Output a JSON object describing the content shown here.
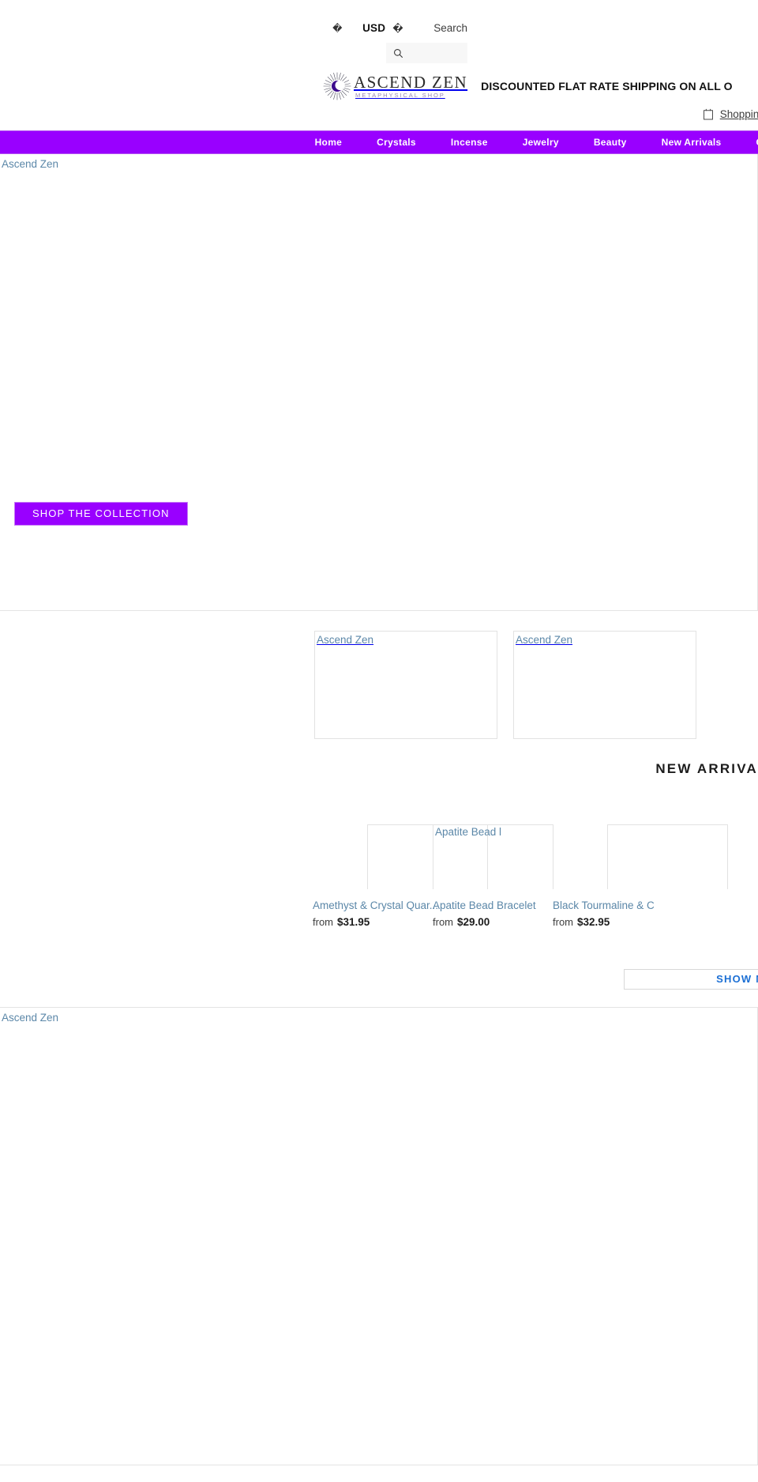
{
  "site": {
    "brand_name": "ASCEND ZEN",
    "brand_tagline": "METAPHYSICAL SHOP",
    "broken_image_alt": "Ascend Zen"
  },
  "topbar": {
    "locale_glyph": "�",
    "currency": "USD",
    "currency_caret_glyph": "�",
    "search_label": "Search",
    "search_placeholder": "",
    "search_value": "",
    "search_icon": "search-icon"
  },
  "announcement": {
    "text": "DISCOUNTED FLAT RATE SHIPPING ON ALL O"
  },
  "cart": {
    "icon": "shopping-bag-icon",
    "label": "Shopping Cart"
  },
  "nav": {
    "items": [
      {
        "label": "Home"
      },
      {
        "label": "Crystals"
      },
      {
        "label": "Incense"
      },
      {
        "label": "Jewelry"
      },
      {
        "label": "Beauty"
      },
      {
        "label": "New Arrivals"
      },
      {
        "label": "Gift"
      }
    ]
  },
  "hero": {
    "alt": "Ascend Zen",
    "cta_label": "SHOP THE COLLECTION"
  },
  "tiles": [
    {
      "alt": "Ascend Zen"
    },
    {
      "alt": "Ascend Zen"
    }
  ],
  "new_arrivals": {
    "heading": "NEW ARRIVA",
    "show_more_label": "SHOW MORE",
    "products": [
      {
        "alt": "",
        "title": "Amethyst & Crystal Quar...",
        "price_prefix": "from",
        "price": "$31.95"
      },
      {
        "alt": "Apatite Bead l",
        "title": "Apatite Bead Bracelet",
        "price_prefix": "from",
        "price": "$29.00"
      },
      {
        "alt": "",
        "title": "Black Tourmaline & C",
        "price_prefix": "from",
        "price": "$32.95"
      }
    ]
  },
  "bottom_banner": {
    "alt": "Ascend Zen"
  },
  "colors": {
    "brand_purple": "#9900ff",
    "link_blue": "#5b87a8",
    "button_blue": "#1b6fd4"
  }
}
